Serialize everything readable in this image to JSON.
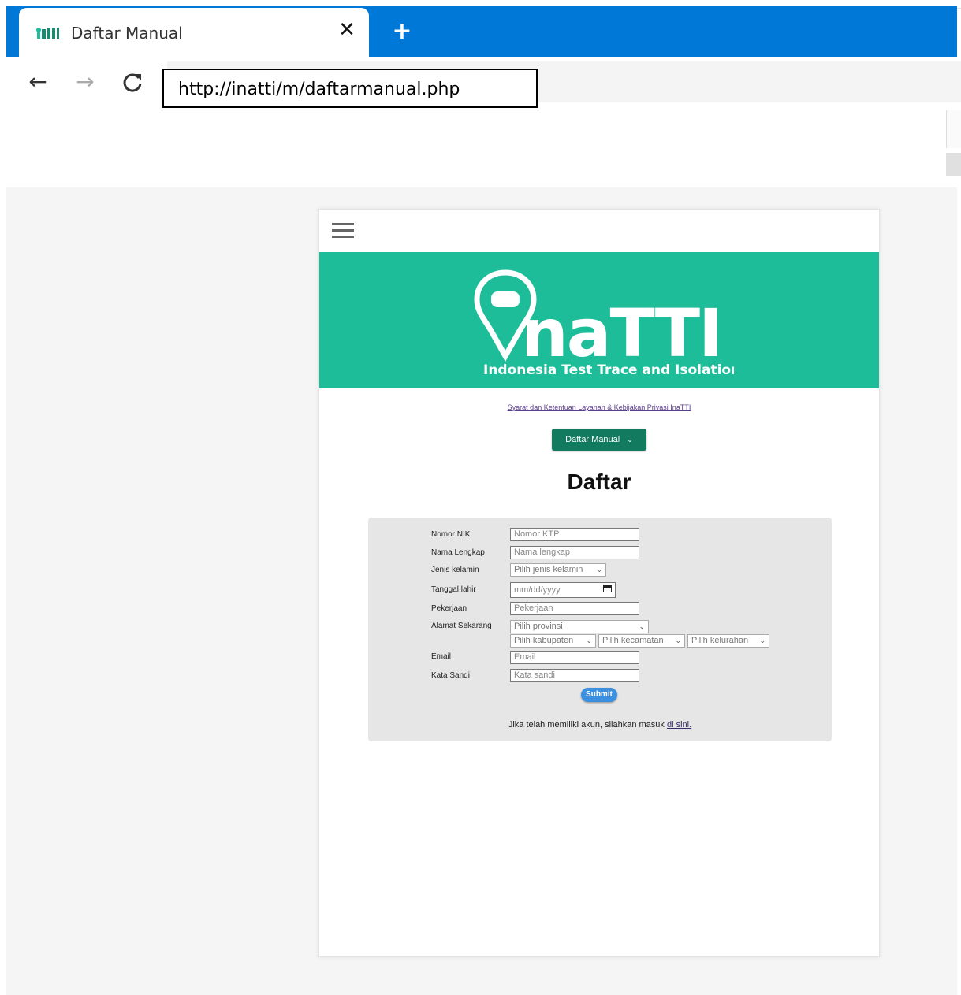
{
  "browser": {
    "tab_title": "Daftar Manual",
    "tab_close_glyph": "✕",
    "new_tab_glyph": "+",
    "address": "http://inatti/m/daftarmanual.php",
    "back_glyph": "←",
    "forward_glyph": "→",
    "reload_glyph": "C"
  },
  "header": {
    "menu_icon": "hamburger-icon"
  },
  "banner": {
    "brand": "naTTI",
    "tagline": "Indonesia Test Trace and Isolation",
    "color": "#1dbd9a"
  },
  "terms_link": "Syarat dan Ketentuan Layanan & Kebijakan Privasi InaTTI",
  "mode_dropdown": {
    "label": "Daftar Manual",
    "color": "#127a5e"
  },
  "title": "Daftar",
  "form": {
    "nik_label": "Nomor NIK",
    "nik_placeholder": "Nomor KTP",
    "name_label": "Nama Lengkap",
    "name_placeholder": "Nama lengkap",
    "gender_label": "Jenis kelamin",
    "gender_select": "Pilih jenis kelamin",
    "dob_label": "Tanggal lahir",
    "dob_placeholder": "mm/dd/yyyy",
    "job_label": "Pekerjaan",
    "job_placeholder": "Pekerjaan",
    "address_label": "Alamat Sekarang",
    "province_select": "Pilih provinsi",
    "regency_select": "Pilih kabupaten",
    "district_select": "Pilih kecamatan",
    "village_select": "Pilih kelurahan",
    "email_label": "Email",
    "email_placeholder": "Email",
    "password_label": "Kata Sandi",
    "password_placeholder": "Kata sandi",
    "submit_label": "Submit",
    "login_text": "Jika telah memiliki akun, silahkan masuk ",
    "login_link": "di sini."
  }
}
